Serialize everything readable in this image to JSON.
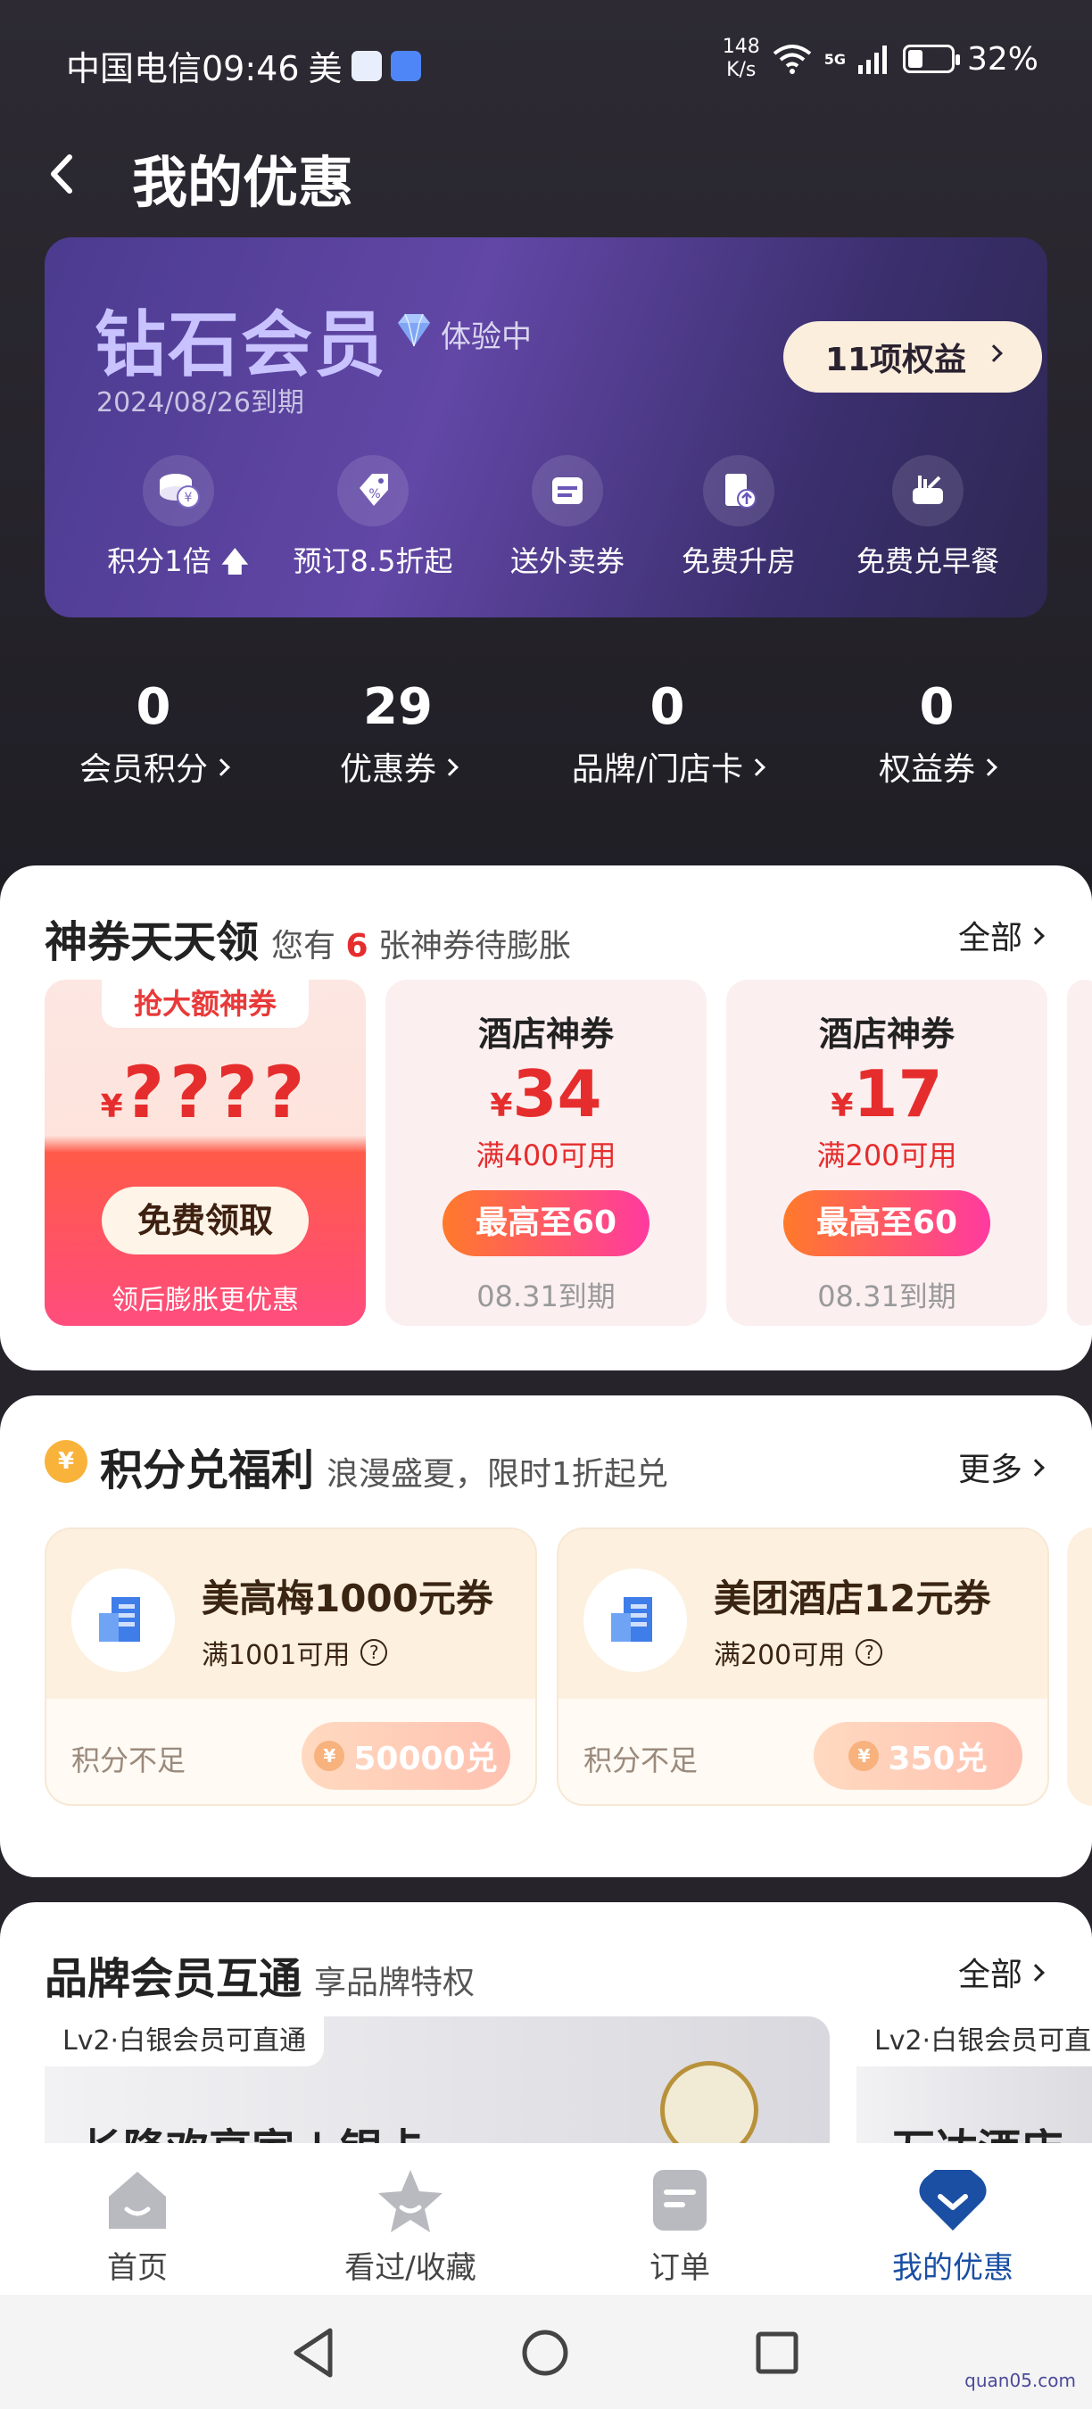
{
  "status_bar": {
    "carrier_time": "中国电信09:46",
    "app_label": "美",
    "net_speed_value": "148",
    "net_speed_unit": "K/s",
    "network": "5G",
    "battery": "32%"
  },
  "header": {
    "title": "我的优惠"
  },
  "vip_card": {
    "level": "钻石会员",
    "trial": "体验中",
    "expire": "2024/08/26到期",
    "rights_button": "11项权益",
    "perks": [
      {
        "label": "积分1倍",
        "icon": "coins-icon"
      },
      {
        "label": "预订8.5折起",
        "icon": "discount-tag-icon"
      },
      {
        "label": "送外卖券",
        "icon": "delivery-ticket-icon"
      },
      {
        "label": "免费升房",
        "icon": "room-upgrade-icon"
      },
      {
        "label": "免费兑早餐",
        "icon": "breakfast-icon"
      }
    ]
  },
  "stats": [
    {
      "value": "0",
      "label": "会员积分"
    },
    {
      "value": "29",
      "label": "优惠券"
    },
    {
      "value": "0",
      "label": "品牌/门店卡"
    },
    {
      "value": "0",
      "label": "权益券"
    }
  ],
  "coupons_section": {
    "title": "神券天天领",
    "sub_prefix": "您有",
    "sub_count": "6",
    "sub_suffix": "张神券待膨胀",
    "more": "全部",
    "grab": {
      "tag": "抢大额神券",
      "currency": "¥",
      "amount": "????",
      "button": "免费领取",
      "note": "领后膨胀更优惠"
    },
    "items": [
      {
        "title": "酒店神券",
        "currency": "¥",
        "amount": "34",
        "condition": "满400可用",
        "button": "最高至60",
        "expire": "08.31到期"
      },
      {
        "title": "酒店神券",
        "currency": "¥",
        "amount": "17",
        "condition": "满200可用",
        "button": "最高至60",
        "expire": "08.31到期"
      }
    ]
  },
  "points_section": {
    "title": "积分兑福利",
    "subtitle": "浪漫盛夏，限时1折起兑",
    "more": "更多",
    "items": [
      {
        "name": "美高梅1000元券",
        "condition": "满1001可用",
        "status": "积分不足",
        "price": "50000兑"
      },
      {
        "name": "美团酒店12元券",
        "condition": "满200可用",
        "status": "积分不足",
        "price": "350兑"
      }
    ]
  },
  "brand_section": {
    "title": "品牌会员互通",
    "subtitle": "享品牌特权",
    "more": "全部",
    "cards": [
      {
        "tag": "Lv2·白银会员可直通",
        "name": "长隆欢享家 | 银卡"
      },
      {
        "tag": "Lv2·白银会员可直",
        "name": "万达酒店"
      }
    ]
  },
  "bottom_nav": [
    {
      "label": "首页",
      "icon": "home-icon",
      "active": false
    },
    {
      "label": "看过/收藏",
      "icon": "star-icon",
      "active": false
    },
    {
      "label": "订单",
      "icon": "order-icon",
      "active": false
    },
    {
      "label": "我的优惠",
      "icon": "coupon-heart-icon",
      "active": true
    }
  ],
  "watermark": "quan05.com",
  "colors": {
    "accent_red": "#e62d2d",
    "nav_active": "#1a4fa3",
    "dark_bg": "#26232b"
  }
}
